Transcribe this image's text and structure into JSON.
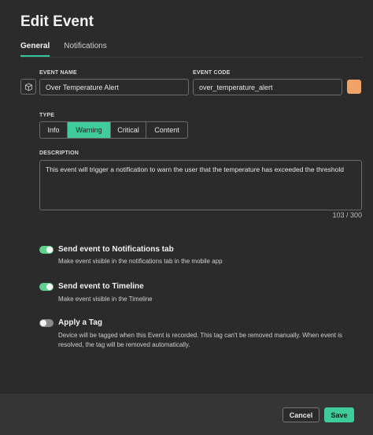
{
  "dialog": {
    "title": "Edit Event"
  },
  "tabs": [
    {
      "label": "General",
      "active": true
    },
    {
      "label": "Notifications",
      "active": false
    }
  ],
  "fields": {
    "event_name": {
      "label": "EVENT NAME",
      "value": "Over Temperature Alert",
      "icon": "cube-icon"
    },
    "event_code": {
      "label": "EVENT CODE",
      "value": "over_temperature_alert",
      "color": "#f0a267"
    }
  },
  "type": {
    "label": "TYPE",
    "options": [
      "Info",
      "Warning",
      "Critical",
      "Content"
    ],
    "selected": "Warning",
    "selected_color": "#3ecc9a"
  },
  "description": {
    "label": "DESCRIPTION",
    "value": "This event will trigger a notification to warn the user that the temperature has exceeded the threshold",
    "counter": "103 / 300"
  },
  "options": [
    {
      "title": "Send event to Notifications tab",
      "subtitle": "Make event visible in the notifications tab in the mobile app",
      "enabled": true
    },
    {
      "title": "Send event to Timeline",
      "subtitle": "Make event visible in the Timeline",
      "enabled": true
    },
    {
      "title": "Apply a Tag",
      "subtitle": "Device will be tagged when this Event is recorded. This tag can't be removed manually. When event is resolved, the tag will be removed automatically.",
      "enabled": false
    }
  ],
  "footer": {
    "cancel_label": "Cancel",
    "save_label": "Save"
  },
  "colors": {
    "accent": "#3ecc9a",
    "background": "#2b2b2b"
  }
}
